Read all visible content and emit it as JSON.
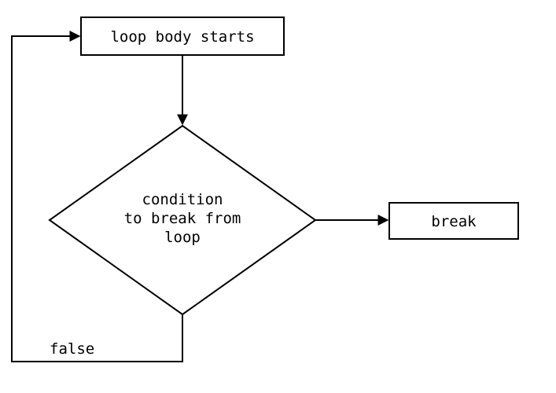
{
  "diagram": {
    "nodes": {
      "start": {
        "label": "loop body starts"
      },
      "condition": {
        "line1": "condition",
        "line2": "to break from",
        "line3": "loop"
      },
      "break": {
        "label": "break"
      }
    },
    "edges": {
      "false_label": "false"
    }
  }
}
